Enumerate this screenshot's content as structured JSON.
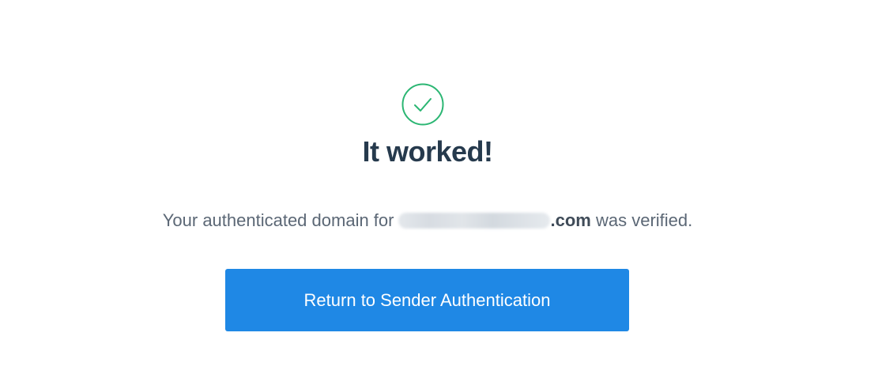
{
  "status": {
    "icon": "check-circle-icon",
    "icon_color": "#2bb673",
    "title": "It worked!",
    "title_color": "#263a4d"
  },
  "message": {
    "prefix": "Your authenticated domain for",
    "domain_tld": ".com",
    "suffix": "was verified.",
    "text_color": "#5b6775"
  },
  "action": {
    "button_label": "Return to Sender Authentication",
    "button_color": "#1f88e5"
  }
}
